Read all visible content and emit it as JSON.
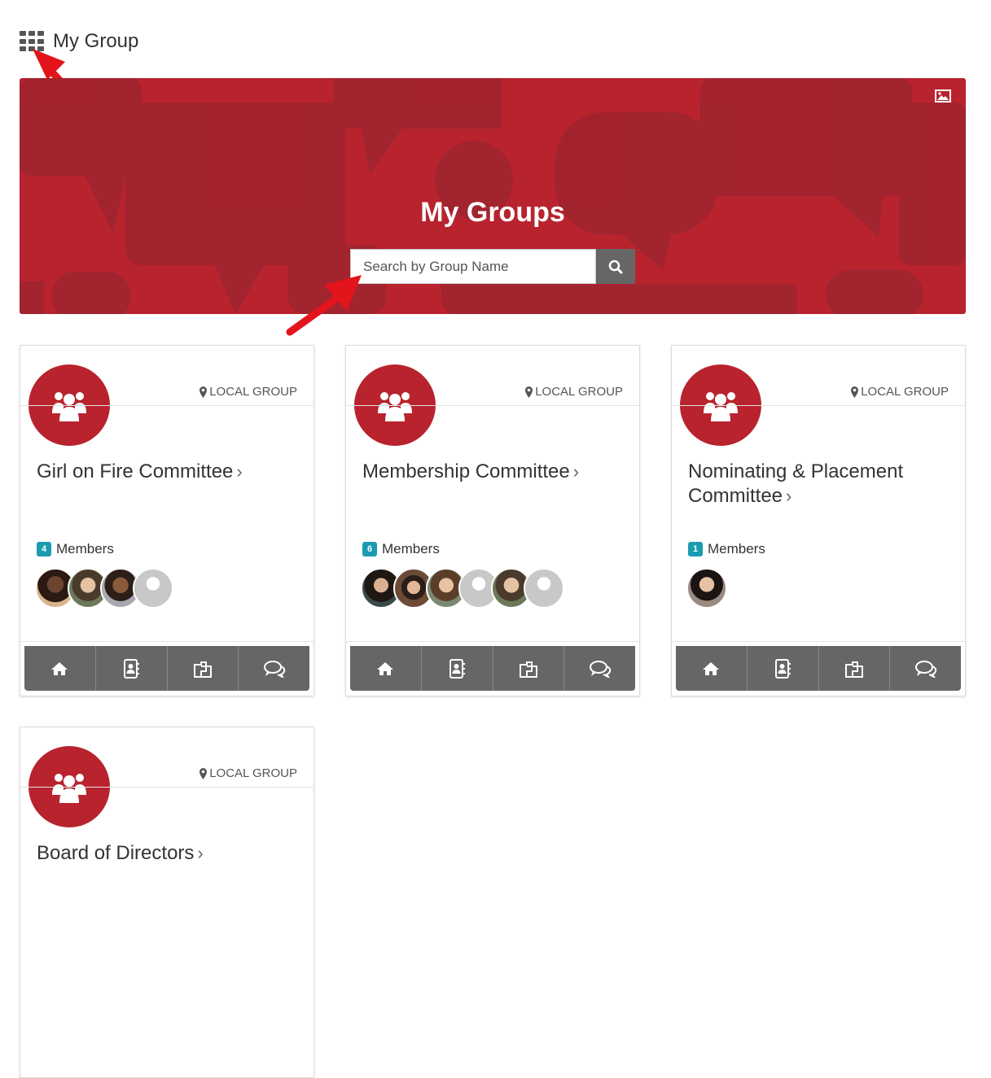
{
  "header": {
    "title": "My Group",
    "menu_icon": "grid-icon"
  },
  "banner": {
    "title": "My Groups",
    "background_color": "#b8232e",
    "search": {
      "placeholder": "Search by Group Name",
      "button_icon": "search-icon"
    },
    "image_icon": "image-icon"
  },
  "colors": {
    "accent": "#b8232e",
    "badge": "#1b9bb0",
    "action_bar": "#666666",
    "arrow": "#e3141b"
  },
  "groups": [
    {
      "type": "LOCAL GROUP",
      "name": "Girl on Fire Committee",
      "member_count": "4",
      "members_label": "Members",
      "chevron": "›"
    },
    {
      "type": "LOCAL GROUP",
      "name": "Membership Committee",
      "member_count": "6",
      "members_label": "Members",
      "chevron": "›"
    },
    {
      "type": "LOCAL GROUP",
      "name": "Nominating & Placement Committee",
      "member_count": "1",
      "members_label": "Members",
      "chevron": "›"
    },
    {
      "type": "LOCAL GROUP",
      "name": "Board of Directors",
      "member_count": "",
      "members_label": "",
      "chevron": "›"
    }
  ],
  "card_actions": [
    "home-icon",
    "directory-icon",
    "documents-icon",
    "discussion-icon"
  ]
}
